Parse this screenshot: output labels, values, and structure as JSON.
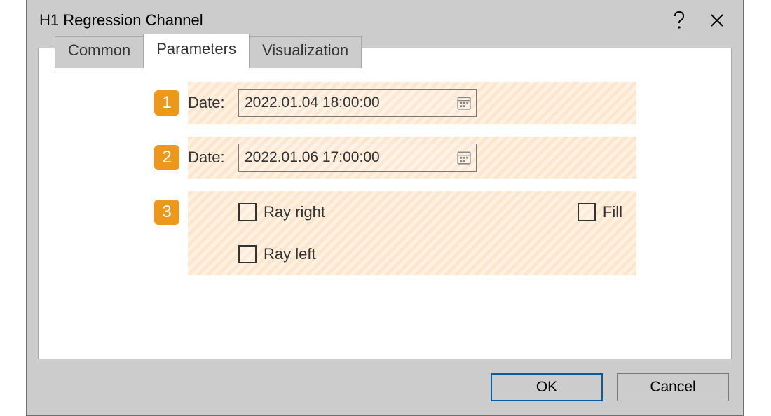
{
  "window": {
    "title": "H1 Regression Channel"
  },
  "tabs": {
    "common": "Common",
    "parameters": "Parameters",
    "visualization": "Visualization"
  },
  "rows": {
    "badge1": "1",
    "label1": "Date:",
    "value1": "2022.01.04 18:00:00",
    "badge2": "2",
    "label2": "Date:",
    "value2": "2022.01.06 17:00:00",
    "badge3": "3",
    "ray_right": "Ray right",
    "fill": "Fill",
    "ray_left": "Ray left"
  },
  "buttons": {
    "ok": "OK",
    "cancel": "Cancel"
  }
}
